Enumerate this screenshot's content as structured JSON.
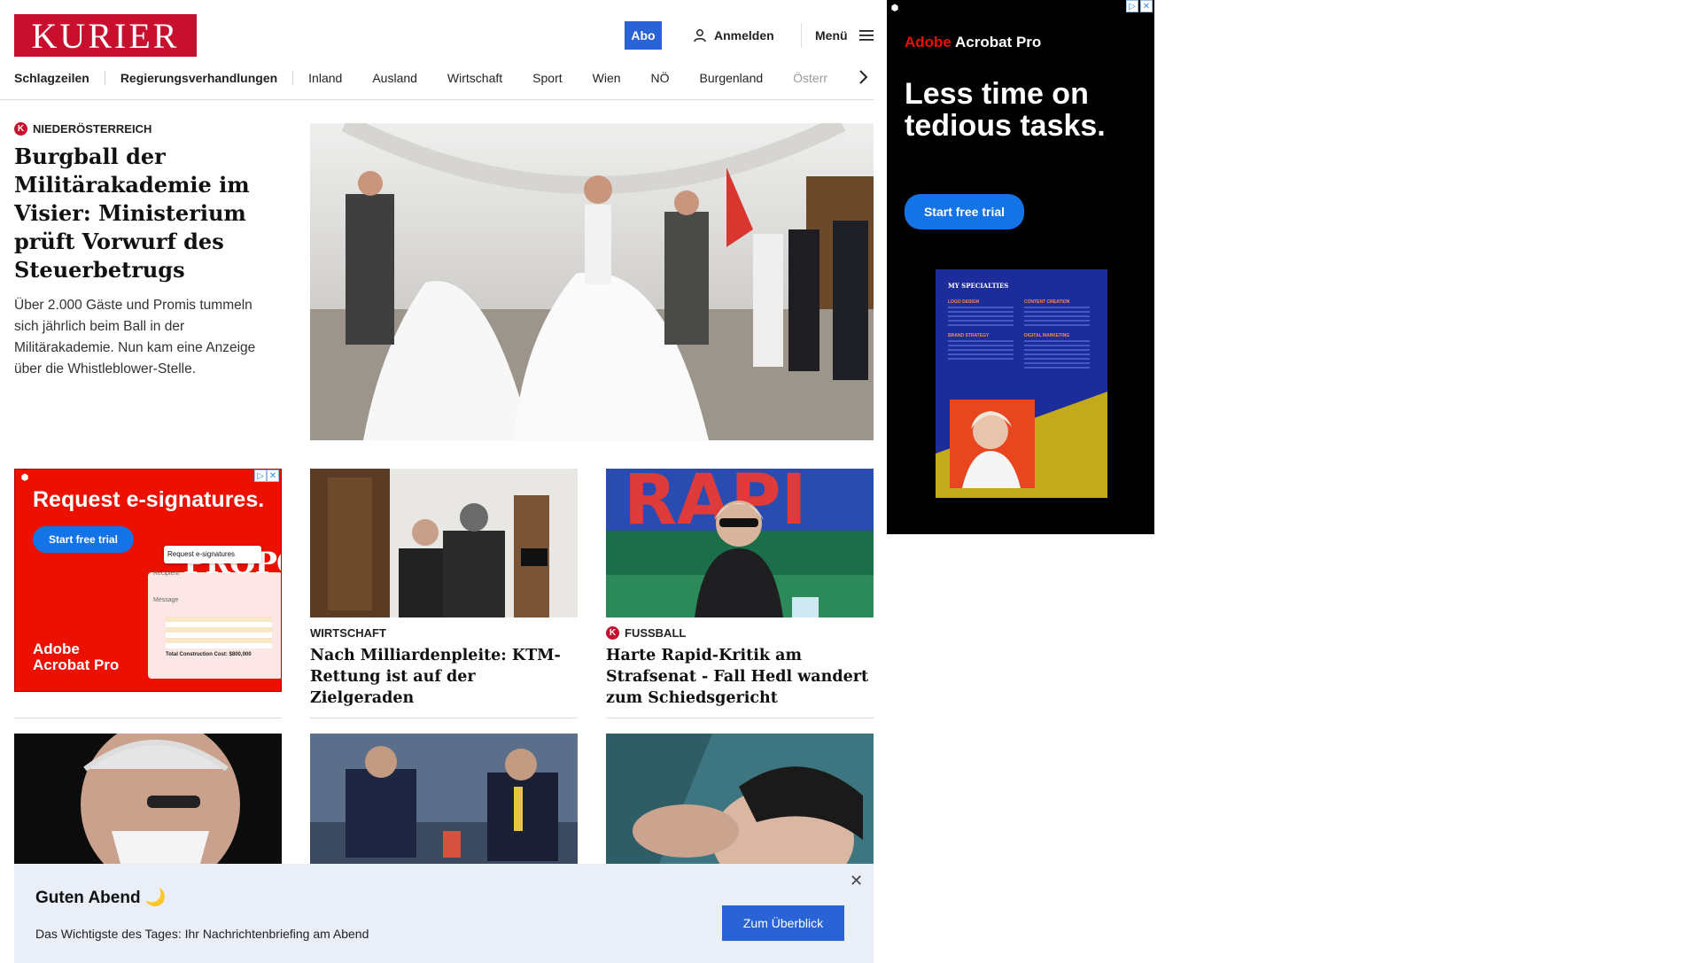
{
  "header": {
    "logo": "KURIER",
    "abo_label": "Abo",
    "login_label": "Anmelden",
    "menu_label": "Menü",
    "brand_color": "#c8102e",
    "accent_color": "#2a63d6"
  },
  "nav": {
    "items": [
      "Schlagzeilen",
      "Regierungsverhandlungen",
      "Inland",
      "Ausland",
      "Wirtschaft",
      "Sport",
      "Wien",
      "NÖ",
      "Burgenland",
      "Österr"
    ]
  },
  "hero": {
    "kicker": "NIEDERÖSTERREICH",
    "badge": "K",
    "title": "Burgball der Militärakademie im Visier: Ministerium prüft Vorwurf des Steuerbetrugs",
    "teaser": "Über 2.000 Gäste und Promis tummeln sich jährlich beim Ball in der Militärakademie. Nun kam eine Anzeige über die Whistleblower-Stelle."
  },
  "cards": [
    {
      "kicker": "WIRTSCHAFT",
      "title": "Nach Milliardenpleite: KTM-Rettung ist auf der Zielgeraden"
    },
    {
      "kicker": "FUSSBALL",
      "badge": "K",
      "title": "Harte Rapid-Kritik am Strafsenat - Fall Hedl wandert zum Schiedsgericht"
    }
  ],
  "ad_small": {
    "headline": "Request e-signatures.",
    "button": "Start free trial",
    "doc_label": "Request e-signatures",
    "doc_recipient": "Recipient",
    "doc_message": "Message",
    "doc_total": "Total Construction Cost: $800,000",
    "brand_line1": "Adobe",
    "brand_line2": "Acrobat Pro",
    "bg_color": "#eb1000"
  },
  "ad_right": {
    "brand_adobe": "Adobe",
    "brand_product": " Acrobat Pro",
    "headline": "Less time on tedious tasks.",
    "button": "Start free trial",
    "poster_title": "MY SPECIALTIES",
    "poster_labels": [
      "LOGO DESIGN",
      "CONTENT CREATION",
      "BRAND STRATEGY",
      "DIGITAL MARKETING"
    ]
  },
  "banner": {
    "title": "Guten Abend 🌙",
    "subtitle": "Das Wichtigste des Tages: Ihr Nachrichtenbriefing am Abend",
    "cta": "Zum Überblick",
    "close_glyph": "✕"
  }
}
